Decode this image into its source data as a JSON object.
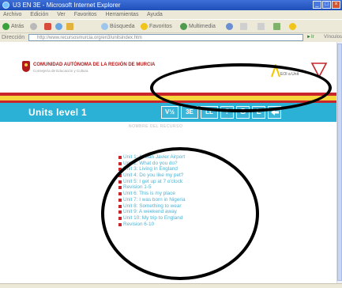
{
  "window": {
    "title": "U3 EN 3E - Microsoft Internet Explorer"
  },
  "menu": [
    "Archivo",
    "Edición",
    "Ver",
    "Favoritos",
    "Herramientas",
    "Ayuda"
  ],
  "toolbar": {
    "back_label": "Atrás",
    "search_label": "Búsqueda",
    "favorites_label": "Favoritos",
    "multimedia_label": "Multimedia"
  },
  "addressbar": {
    "label": "Dirección",
    "url": "http://www.recursosmurcia.org/en3/unitsindex.htm",
    "go_label": "Ir",
    "links_label": "Vínculos"
  },
  "header": {
    "region_title": "COMUNIDAD AUTÓNOMA DE LA REGIÓN DE MURCIA",
    "region_subtitle": "Consejería de Educación y Cultura",
    "logo_text": "EOI a Unit"
  },
  "units_bar": {
    "title": "Units level 1",
    "nav_buttons": [
      "V½",
      "3E",
      "LL",
      "?",
      "G",
      "L",
      "◄"
    ]
  },
  "caption": "NOMBRE DEL RECURSO",
  "units": [
    "Unit 1: At San Javier Airport",
    "Unit 2: What do you do?",
    "Unit 3: Living in England",
    "Unit 4: Do you like my pet?",
    "Unit 5: I get up at 7 o'clock",
    "Revision 1-5",
    "Unit 6: This is my place",
    "Unit 7: I was born in Nigeria",
    "Unit 8: Something to wear",
    "Unit 9: A weekend away",
    "Unit 10: My trip to England",
    "Revision 6-10"
  ],
  "colors": {
    "accent_blue": "#2bb0d6",
    "stripe_red": "#c9252b",
    "stripe_yellow": "#f6d43c",
    "link_blue": "#4fb3d4"
  }
}
